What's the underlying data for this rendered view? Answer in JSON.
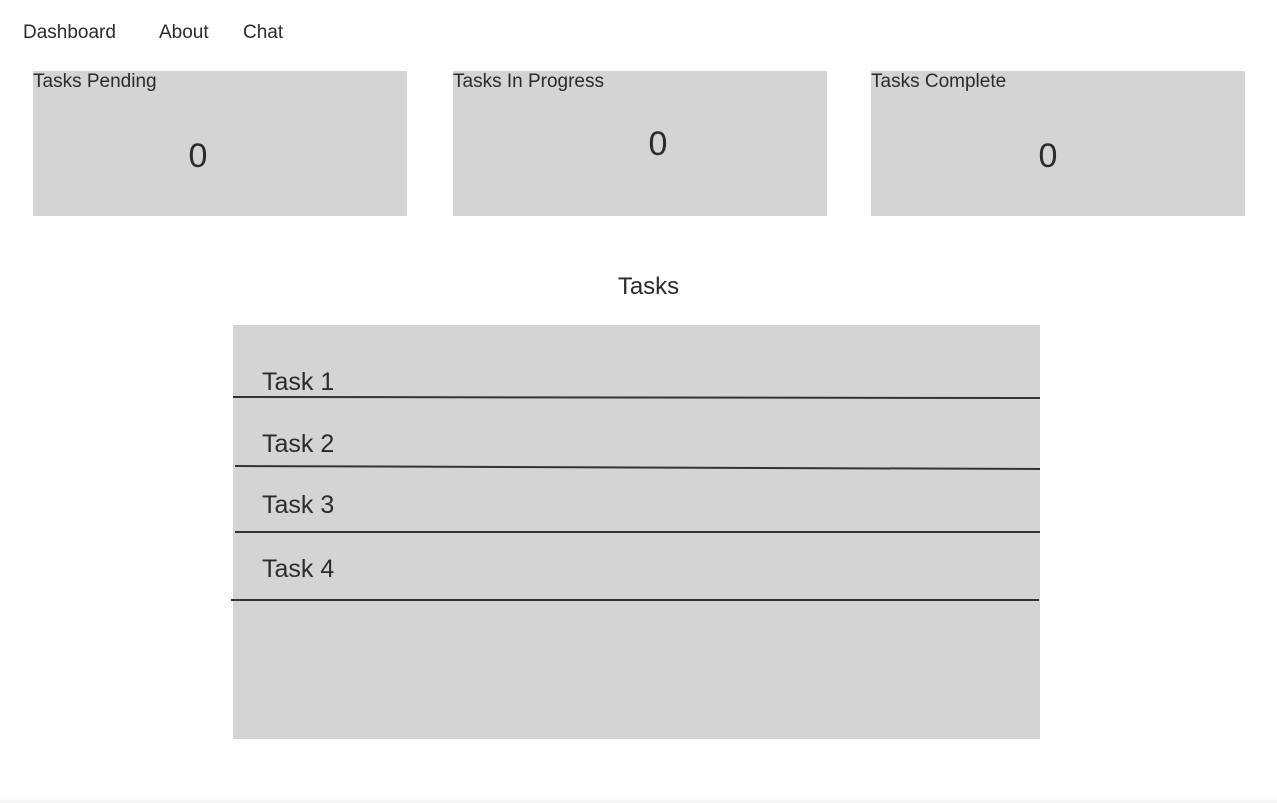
{
  "nav": {
    "items": [
      {
        "label": "Dashboard"
      },
      {
        "label": "About"
      },
      {
        "label": "Chat"
      }
    ]
  },
  "stats": [
    {
      "title": "Tasks Pending",
      "count": "0"
    },
    {
      "title": "Tasks In Progress",
      "count": "0"
    },
    {
      "title": "Tasks Complete",
      "count": "0"
    }
  ],
  "tasks": {
    "heading": "Tasks",
    "items": [
      {
        "label": "Task 1"
      },
      {
        "label": "Task 2"
      },
      {
        "label": "Task 3"
      },
      {
        "label": "Task 4"
      }
    ]
  },
  "colors": {
    "panel_background": "#d4d4d4",
    "text": "#2b2b2b",
    "divider": "#333333"
  }
}
